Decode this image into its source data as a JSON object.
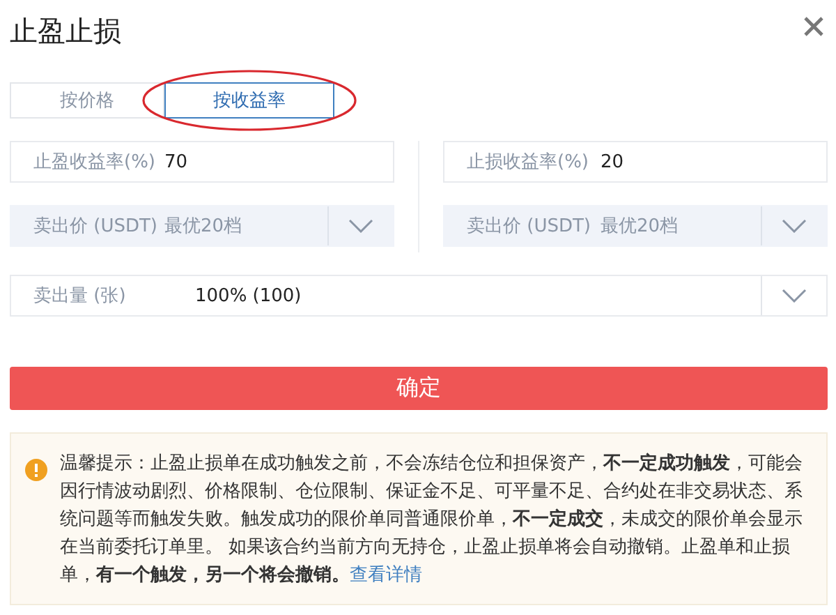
{
  "dialog": {
    "title": "止盈止损"
  },
  "tabs": [
    {
      "label": "按价格",
      "selected": false,
      "circled": false
    },
    {
      "label": "按收益率",
      "selected": true,
      "circled": true
    }
  ],
  "columns": [
    {
      "rate": {
        "label": "止盈收益率(%)",
        "value": "70"
      },
      "price": {
        "label": "卖出价 (USDT)",
        "value": "最优20档",
        "disabled": true
      }
    },
    {
      "rate": {
        "label": "止损收益率(%)",
        "value": "20"
      },
      "price": {
        "label": "卖出价 (USDT)",
        "value": "最优20档",
        "disabled": true
      }
    }
  ],
  "quantity": {
    "label": "卖出量 (张)",
    "value": "100% (100)",
    "disabled": false
  },
  "confirm_button": "确定",
  "notice": {
    "text": "温馨提示：止盈止损单在成功触发之前，不会冻结仓位和担保资产，**不一定成功触发**，可能会因行情波动剧烈、价格限制、仓位限制、保证金不足、可平量不足、合约处在非交易状态、系统问题等而触发失败。触发成功的限价单同普通限价单，**不一定成交**，未成交的限价单会显示在当前委托订单里。 如果该合约当前方向无持仓，止盈止损单将会自动撤销。止盈单和止损单，**有一个触发，另一个将会撤销。**",
    "link": "查看详情"
  }
}
